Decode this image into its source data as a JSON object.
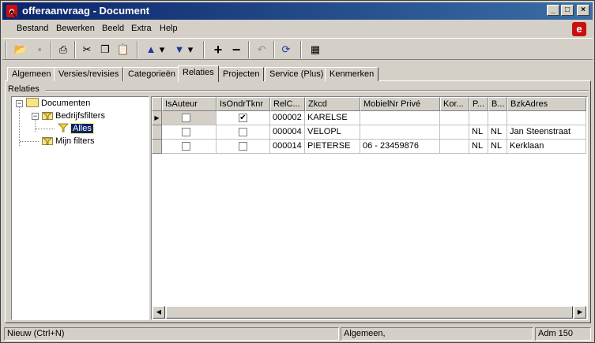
{
  "window": {
    "title": "offeraanvraag - Document",
    "app_letter": "e"
  },
  "title_buttons": {
    "minimize": "_",
    "maximize": "□",
    "close": "×"
  },
  "menu": [
    {
      "label": "Bestand"
    },
    {
      "label": "Bewerken"
    },
    {
      "label": "Beeld"
    },
    {
      "label": "Extra"
    },
    {
      "label": "Help"
    }
  ],
  "toolbar": {
    "open": "📂",
    "save": "▪",
    "print": "⎙",
    "cut": "✂",
    "copy": "❐",
    "paste": "📋",
    "up": "▲",
    "up_drop": "▾",
    "down": "▼",
    "down_drop": "▾",
    "add": "+",
    "remove": "−",
    "undo": "↶",
    "refresh": "⟳",
    "layout": "▦"
  },
  "tabs": [
    {
      "label": "Algemeen"
    },
    {
      "label": "Versies/revisies"
    },
    {
      "label": "Categorieën"
    },
    {
      "label": "Relaties",
      "active": true
    },
    {
      "label": "Projecten"
    },
    {
      "label": "Service (Plus)"
    },
    {
      "label": "Kenmerken"
    }
  ],
  "group_label": "Relaties",
  "tree": {
    "root": "Documenten",
    "bedrijfsfilters": "Bedrijfsfilters",
    "alles": "Alles",
    "mijn_filters": "Mijn filters"
  },
  "grid": {
    "columns": [
      "IsAuteur",
      "IsOndrTknr",
      "RelC...",
      "Zkcd",
      "MobielNr Privé",
      "Kor...",
      "P...",
      "B...",
      "BzkAdres"
    ],
    "rows": [
      {
        "isauteur": false,
        "isondrtknr": true,
        "relcode": "000002",
        "zkcd": "KARELSE",
        "mobiel": "",
        "kor": "",
        "p": "",
        "b": "",
        "adres": ""
      },
      {
        "isauteur": false,
        "isondrtknr": false,
        "relcode": "000004",
        "zkcd": "VELOPL",
        "mobiel": "",
        "kor": "",
        "p": "NL",
        "b": "NL",
        "adres": "Jan Steenstraat"
      },
      {
        "isauteur": false,
        "isondrtknr": false,
        "relcode": "000014",
        "zkcd": "PIETERSE",
        "mobiel": "06 - 23459876",
        "kor": "",
        "p": "NL",
        "b": "NL",
        "adres": "Kerklaan"
      }
    ],
    "current_row_marker": "▶",
    "check_mark": "✔"
  },
  "status": {
    "hint": "Nieuw (Ctrl+N)",
    "section": "Algemeen,",
    "user": "Adm 150"
  }
}
